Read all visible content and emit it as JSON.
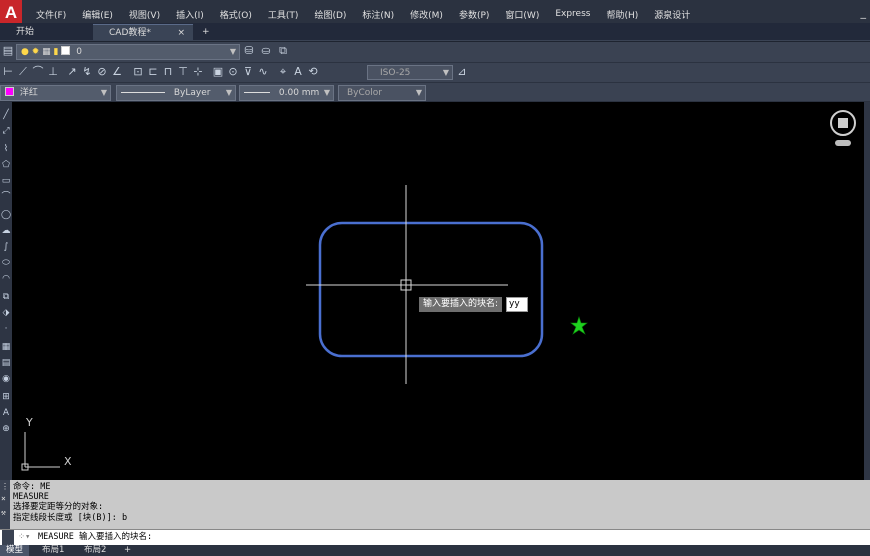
{
  "app": {
    "logo_text": "A",
    "min_button": "_"
  },
  "menu": {
    "items": [
      "文件(F)",
      "编辑(E)",
      "视图(V)",
      "插入(I)",
      "格式(O)",
      "工具(T)",
      "绘图(D)",
      "标注(N)",
      "修改(M)",
      "参数(P)",
      "窗口(W)",
      "Express",
      "帮助(H)",
      "源泉设计"
    ]
  },
  "tabs": {
    "start": "开始",
    "document": "CAD教程*",
    "close": "×",
    "add": "+"
  },
  "toolbar_layers": {
    "layer_value": "0"
  },
  "toolbar_dims": {
    "dimstyle_value": "ISO-25"
  },
  "properties": {
    "color_value": "洋红",
    "color_hex": "#ff00ff",
    "linetype_value": "ByLayer",
    "lineweight_value": "0.00 mm",
    "plotstyle_value": "ByColor"
  },
  "canvas": {
    "prompt_label": "输入要插入的块名:",
    "prompt_input": "yy",
    "ucs_y": "Y",
    "ucs_x": "X",
    "rect_color": "#4a6fd0",
    "marker_color": "#1fd11f"
  },
  "command": {
    "history": [
      "命令: ME",
      "MEASURE",
      "选择要定距等分的对象:",
      "指定线段长度或 [块(B)]: b"
    ],
    "current": "MEASURE 输入要插入的块名:"
  },
  "layout_tabs": {
    "model": "模型",
    "layout1": "布局1",
    "layout2": "布局2",
    "add": "+"
  }
}
